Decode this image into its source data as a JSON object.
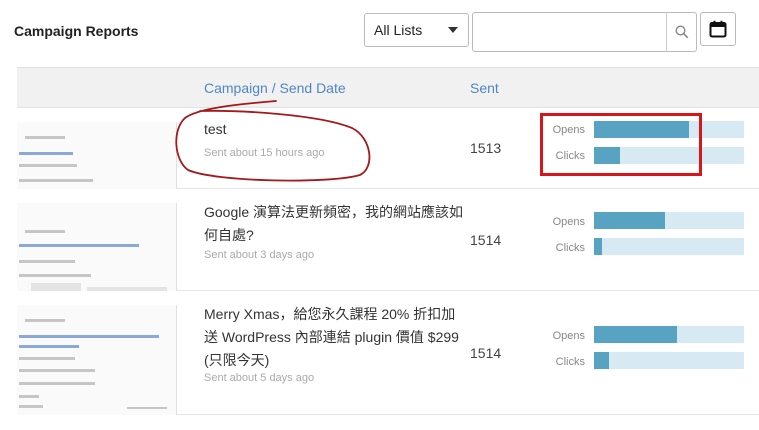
{
  "header": {
    "title": "Campaign Reports",
    "list_filter": {
      "selected": "All Lists"
    },
    "search": {
      "value": "",
      "placeholder": ""
    }
  },
  "table": {
    "columns": {
      "campaign": "Campaign / Send Date",
      "sent": "Sent"
    },
    "rows": [
      {
        "title": "test",
        "date": "Sent about 15 hours ago",
        "sent": "1513",
        "opens_label": "Opens",
        "clicks_label": "Clicks",
        "opens_rate": 0.63,
        "clicks_rate": 0.17
      },
      {
        "title": "Google 演算法更新頻密，我的網站應該如何自處?",
        "date": "Sent about 3 days ago",
        "sent": "1514",
        "opens_label": "Opens",
        "clicks_label": "Clicks",
        "opens_rate": 0.47,
        "clicks_rate": 0.05
      },
      {
        "title": "Merry Xmas，給您永久課程 20% 折扣加送 WordPress 內部連結 plugin 價值 $299 (只限今天)",
        "date": "Sent about 5 days ago",
        "sent": "1514",
        "opens_label": "Opens",
        "clicks_label": "Clicks",
        "opens_rate": 0.55,
        "clicks_rate": 0.1
      }
    ]
  },
  "colors": {
    "accent": "#4f87c4",
    "bar_fill": "#58a3c2",
    "bar_track": "#d7eaf3",
    "annotation": "#d9151c"
  }
}
